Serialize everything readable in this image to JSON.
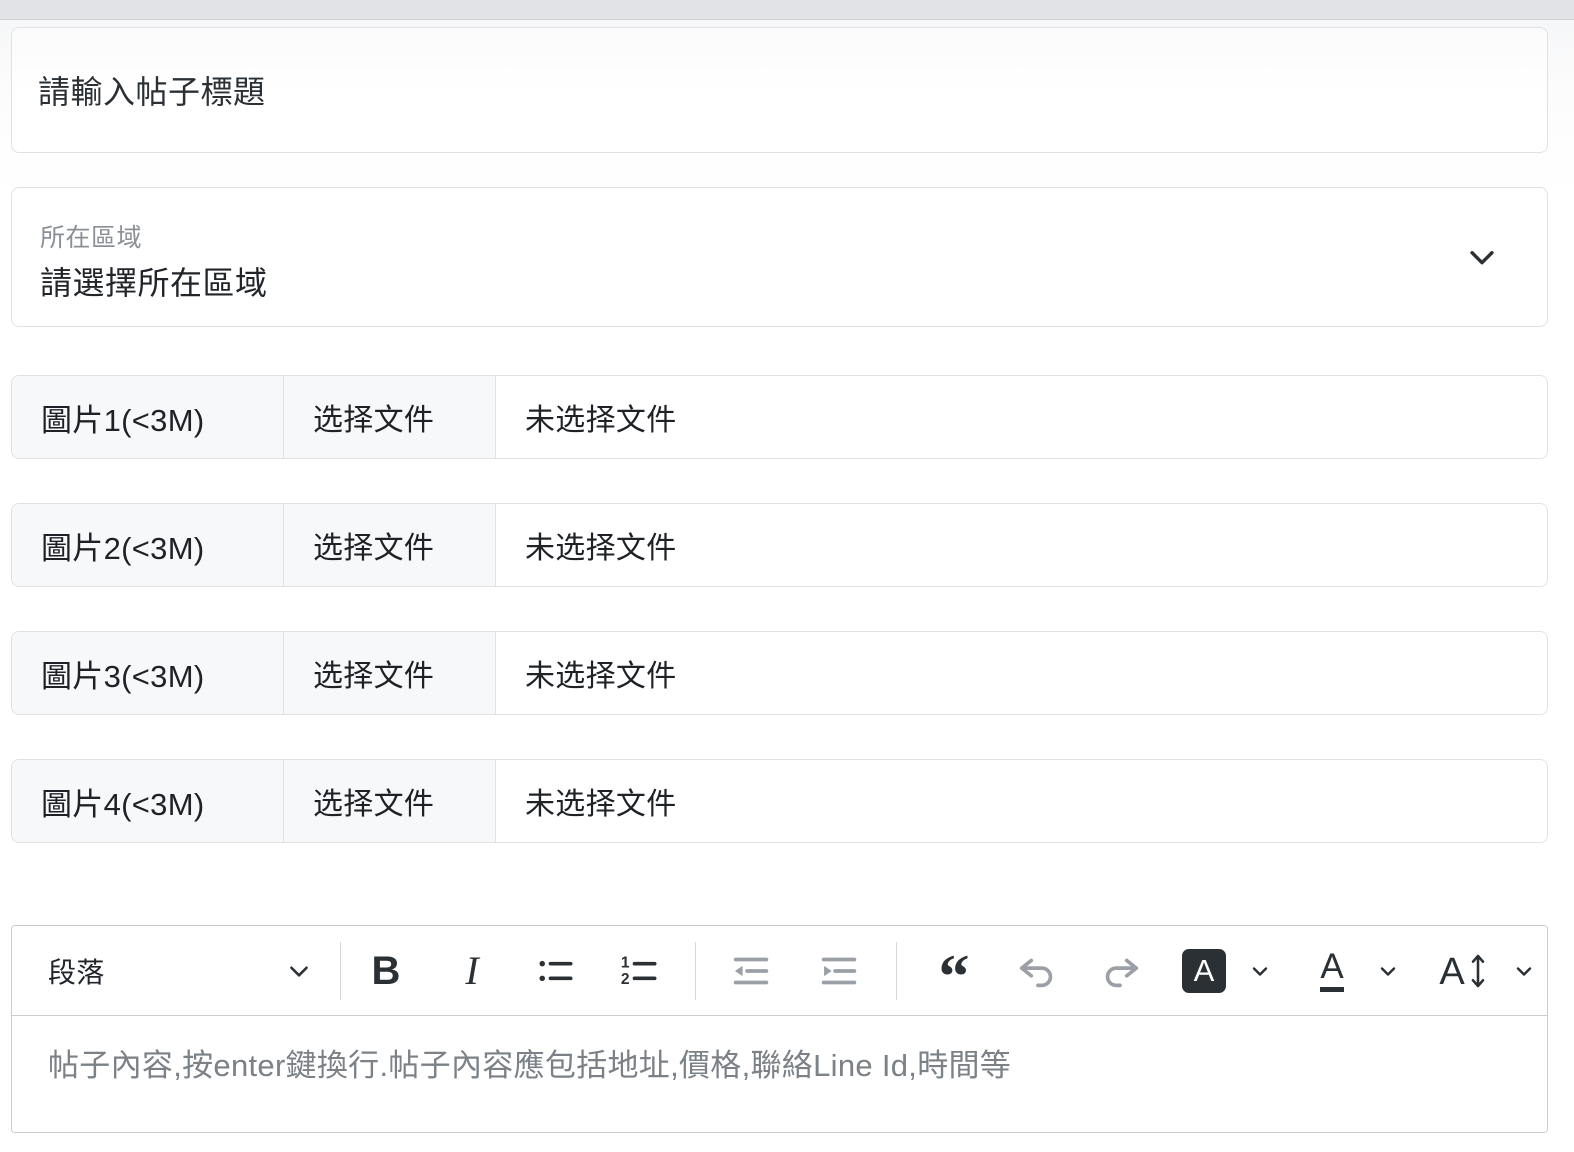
{
  "title_input": {
    "placeholder": "請輸入帖子標題",
    "value": ""
  },
  "region_select": {
    "label": "所在區域",
    "selected": "請選擇所在區域",
    "chevron_icon": "chevron-down-icon"
  },
  "file_rows": [
    {
      "label": "圖片1(<3M)",
      "button": "选择文件",
      "status": "未选择文件"
    },
    {
      "label": "圖片2(<3M)",
      "button": "选择文件",
      "status": "未选择文件"
    },
    {
      "label": "圖片3(<3M)",
      "button": "选择文件",
      "status": "未选择文件"
    },
    {
      "label": "圖片4(<3M)",
      "button": "选择文件",
      "status": "未选择文件"
    }
  ],
  "editor": {
    "block_format": {
      "selected": "段落",
      "chevron_icon": "chevron-down-icon"
    },
    "toolbar": [
      {
        "name": "bold",
        "glyph": "B",
        "title": "Bold",
        "disabled": false
      },
      {
        "name": "italic",
        "glyph": "I",
        "title": "Italic",
        "disabled": false
      },
      {
        "name": "bullet-list",
        "glyph": "",
        "title": "Bulleted list",
        "disabled": false
      },
      {
        "name": "numbered-list",
        "glyph": "",
        "title": "Numbered list",
        "disabled": false
      },
      {
        "name": "outdent",
        "glyph": "",
        "title": "Decrease indent",
        "disabled": true
      },
      {
        "name": "indent",
        "glyph": "",
        "title": "Increase indent",
        "disabled": true
      },
      {
        "name": "blockquote",
        "glyph": "“",
        "title": "Blockquote",
        "disabled": false
      },
      {
        "name": "undo",
        "glyph": "",
        "title": "Undo",
        "disabled": true
      },
      {
        "name": "redo",
        "glyph": "",
        "title": "Redo",
        "disabled": true
      },
      {
        "name": "highlight-color",
        "glyph": "A",
        "title": "Highlight color",
        "disabled": false
      },
      {
        "name": "font-color",
        "glyph": "A",
        "title": "Font color",
        "disabled": false
      },
      {
        "name": "font-size",
        "glyph": "A",
        "title": "Font size",
        "disabled": false
      }
    ],
    "placeholder": "帖子內容,按enter鍵換行.帖子內容應包括地址,價格,聯絡Line Id,時間等"
  },
  "colors": {
    "page_background": "#ffffff",
    "card_border": "#dfe1e5",
    "editor_border": "#c9ccd1",
    "label_background": "#f6f8f9",
    "text_primary": "#212529",
    "text_muted": "#8b9096",
    "placeholder": "#7b8186",
    "icon_dark": "#2b3035",
    "icon_disabled": "#9aa0a6",
    "top_strip": "#e2e3e6"
  }
}
